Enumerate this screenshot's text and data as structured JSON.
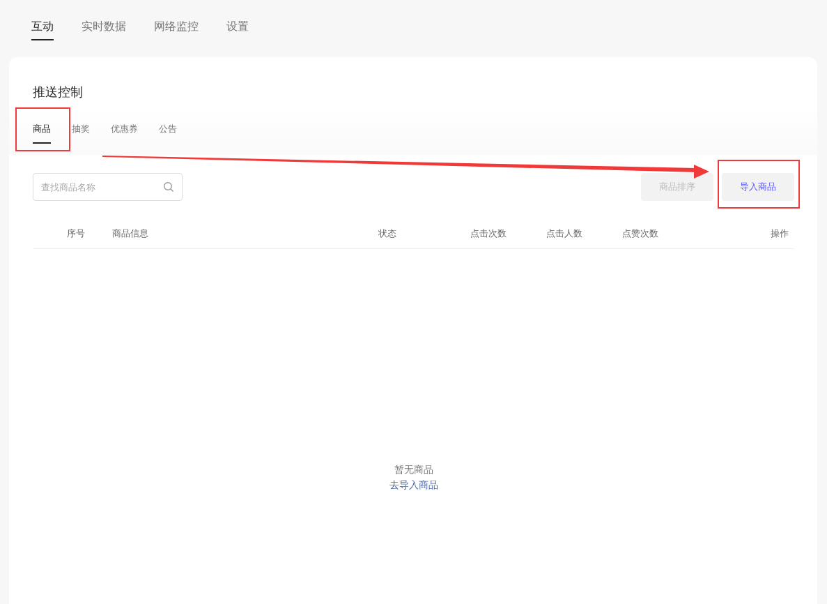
{
  "top_tabs": [
    {
      "label": "互动",
      "selected": true
    },
    {
      "label": "实时数据",
      "selected": false
    },
    {
      "label": "网络监控",
      "selected": false
    },
    {
      "label": "设置",
      "selected": false
    }
  ],
  "panel": {
    "title": "推送控制",
    "tabs": [
      {
        "label": "商品",
        "selected": true
      },
      {
        "label": "抽奖",
        "selected": false
      },
      {
        "label": "优惠券",
        "selected": false
      },
      {
        "label": "公告",
        "selected": false
      }
    ],
    "search": {
      "placeholder": "查找商品名称"
    },
    "buttons": [
      {
        "label": "商品排序",
        "disabled": true
      },
      {
        "label": "导入商品",
        "disabled": false
      }
    ],
    "table": {
      "columns": [
        "序号",
        "商品信息",
        "状态",
        "点击次数",
        "点击人数",
        "点赞次数",
        "操作"
      ]
    },
    "empty_state": {
      "message": "暂无商品",
      "link": "去导入商品"
    }
  }
}
